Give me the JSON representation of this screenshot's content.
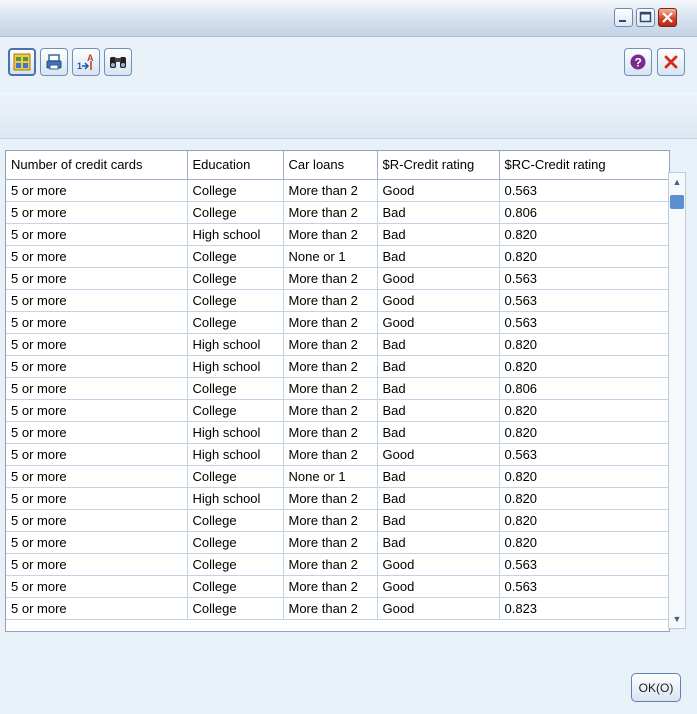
{
  "window": {
    "minimize_icon": "minimize-icon",
    "maximize_icon": "maximize-icon",
    "close_icon": "close-icon"
  },
  "toolbar": {
    "buttons": [
      {
        "icon": "table-view-icon"
      },
      {
        "icon": "print-icon"
      },
      {
        "icon": "sort-icon"
      },
      {
        "icon": "find-binoculars-icon"
      }
    ],
    "help_icon": "help-icon",
    "close_icon": "close-x-icon"
  },
  "table": {
    "columns": [
      "Number of credit cards",
      "Education",
      "Car loans",
      "$R-Credit rating",
      "$RC-Credit rating"
    ],
    "rows": [
      [
        "5 or more",
        "College",
        "More than 2",
        "Good",
        "0.563"
      ],
      [
        "5 or more",
        "College",
        "More than 2",
        "Bad",
        "0.806"
      ],
      [
        "5 or more",
        "High school",
        "More than 2",
        "Bad",
        "0.820"
      ],
      [
        "5 or more",
        "College",
        "None or 1",
        "Bad",
        "0.820"
      ],
      [
        "5 or more",
        "College",
        "More than 2",
        "Good",
        "0.563"
      ],
      [
        "5 or more",
        "College",
        "More than 2",
        "Good",
        "0.563"
      ],
      [
        "5 or more",
        "College",
        "More than 2",
        "Good",
        "0.563"
      ],
      [
        "5 or more",
        "High school",
        "More than 2",
        "Bad",
        "0.820"
      ],
      [
        "5 or more",
        "High school",
        "More than 2",
        "Bad",
        "0.820"
      ],
      [
        "5 or more",
        "College",
        "More than 2",
        "Bad",
        "0.806"
      ],
      [
        "5 or more",
        "College",
        "More than 2",
        "Bad",
        "0.820"
      ],
      [
        "5 or more",
        "High school",
        "More than 2",
        "Bad",
        "0.820"
      ],
      [
        "5 or more",
        "High school",
        "More than 2",
        "Good",
        "0.563"
      ],
      [
        "5 or more",
        "College",
        "None or 1",
        "Bad",
        "0.820"
      ],
      [
        "5 or more",
        "High school",
        "More than 2",
        "Bad",
        "0.820"
      ],
      [
        "5 or more",
        "College",
        "More than 2",
        "Bad",
        "0.820"
      ],
      [
        "5 or more",
        "College",
        "More than 2",
        "Bad",
        "0.820"
      ],
      [
        "5 or more",
        "College",
        "More than 2",
        "Good",
        "0.563"
      ],
      [
        "5 or more",
        "College",
        "More than 2",
        "Good",
        "0.563"
      ],
      [
        "5 or more",
        "College",
        "More than 2",
        "Good",
        "0.823"
      ]
    ]
  },
  "footer": {
    "ok_label": "OK(O)"
  }
}
